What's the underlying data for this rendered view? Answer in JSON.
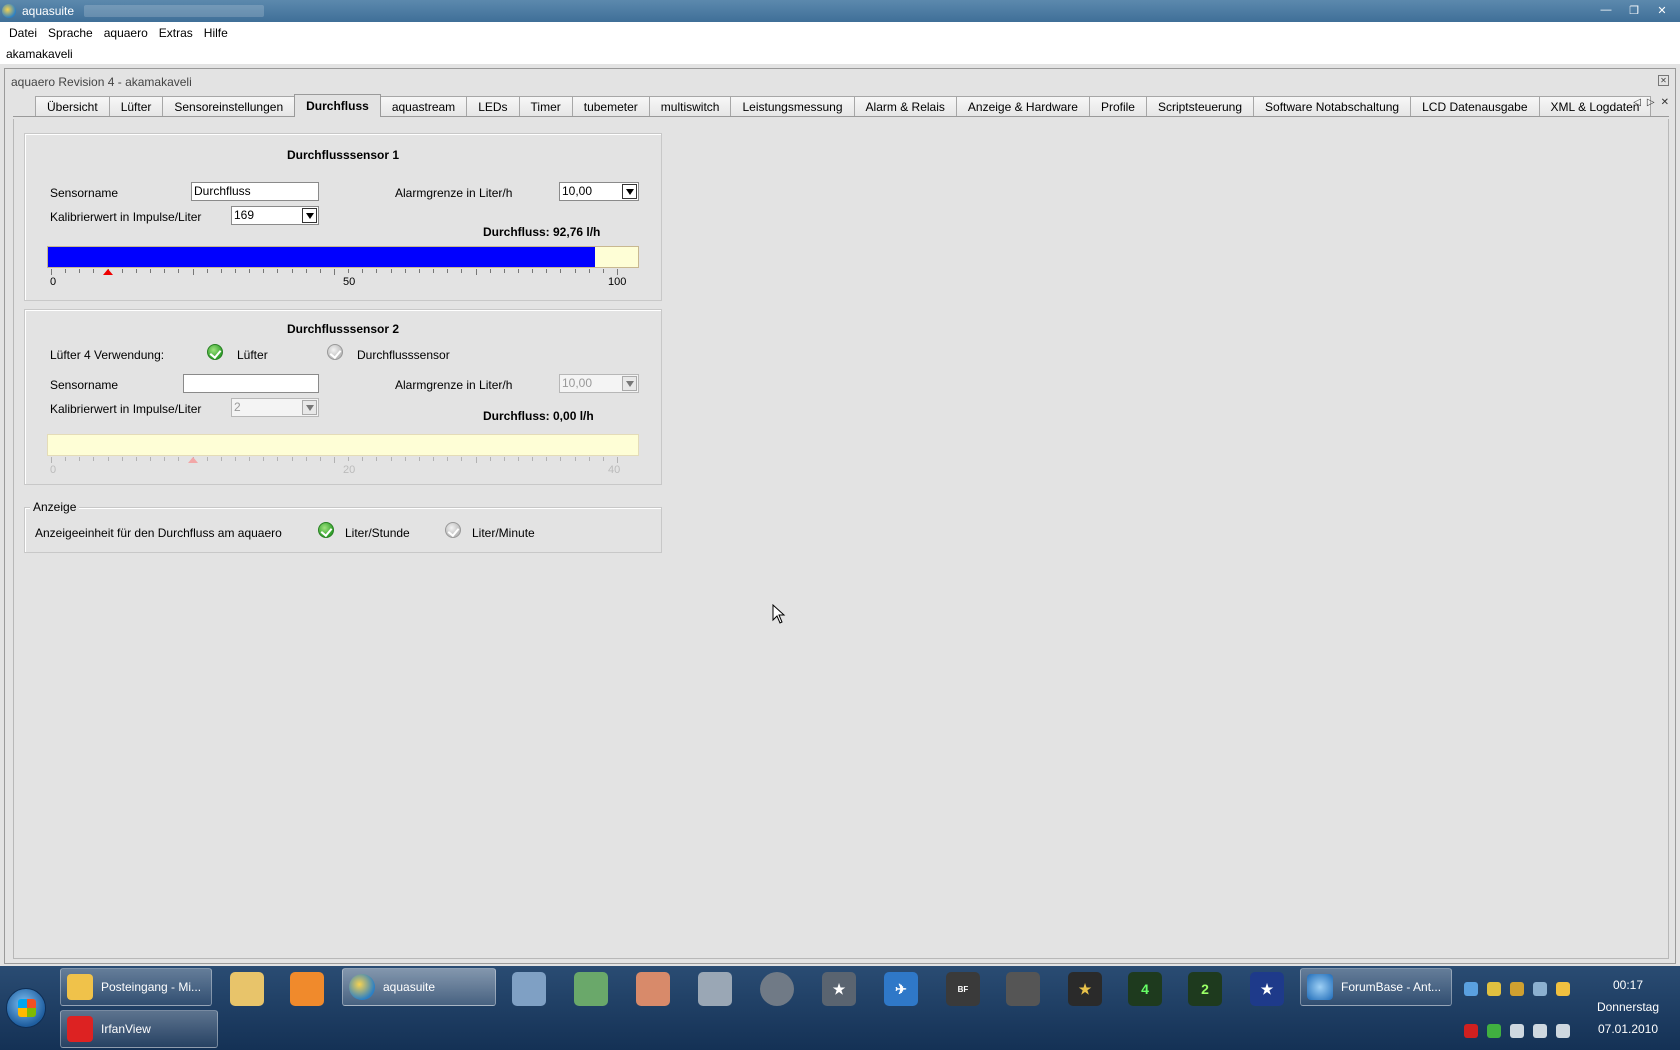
{
  "window": {
    "title": "aquasuite"
  },
  "menu": [
    "Datei",
    "Sprache",
    "aquaero",
    "Extras",
    "Hilfe"
  ],
  "user": "akamakaveli",
  "panel": {
    "title": "aquaero Revision 4 - akamakaveli",
    "tabs": [
      "Übersicht",
      "Lüfter",
      "Sensoreinstellungen",
      "Durchfluss",
      "aquastream",
      "LEDs",
      "Timer",
      "tubemeter",
      "multiswitch",
      "Leistungsmessung",
      "Alarm & Relais",
      "Anzeige & Hardware",
      "Profile",
      "Scriptsteuerung",
      "Software Notabschaltung",
      "LCD Datenausgabe",
      "XML & Logdaten"
    ],
    "active_tab": "Durchfluss"
  },
  "sensor1": {
    "title": "Durchflusssensor 1",
    "name_label": "Sensorname",
    "name_value": "Durchfluss",
    "calib_label": "Kalibrierwert in Impulse/Liter",
    "calib_value": "169",
    "alarm_label": "Alarmgrenze in Liter/h",
    "alarm_value": "10,00",
    "reading": "Durchfluss: 92,76 l/h",
    "bar_fraction": 0.9276,
    "alarm_marker": 10,
    "scale": [
      "0",
      "50",
      "100"
    ]
  },
  "sensor2": {
    "title": "Durchflusssensor 2",
    "usage_label": "Lüfter 4 Verwendung:",
    "opt_fan": "Lüfter",
    "opt_sensor": "Durchflusssensor",
    "name_label": "Sensorname",
    "name_value": "",
    "calib_label": "Kalibrierwert in Impulse/Liter",
    "calib_value": "2",
    "alarm_label": "Alarmgrenze in Liter/h",
    "alarm_value": "10,00",
    "reading": "Durchfluss: 0,00 l/h",
    "bar_fraction": 0,
    "alarm_marker": 10,
    "scale": [
      "0",
      "20",
      "40"
    ]
  },
  "display": {
    "legend": "Anzeige",
    "unit_label": "Anzeigeeinheit für den Durchfluss am aquaero",
    "opt_hour": "Liter/Stunde",
    "opt_minute": "Liter/Minute"
  },
  "taskbar": {
    "tasks": [
      "Posteingang - Mi...",
      "aquasuite",
      "ForumBase - Ant...",
      "IrfanView"
    ],
    "time": "00:17",
    "day": "Donnerstag",
    "date": "07.01.2010"
  },
  "colors": {
    "bar_fill": "#0000ff",
    "bar_bg": "#fefed6",
    "alarm_marker": "#e00000"
  }
}
